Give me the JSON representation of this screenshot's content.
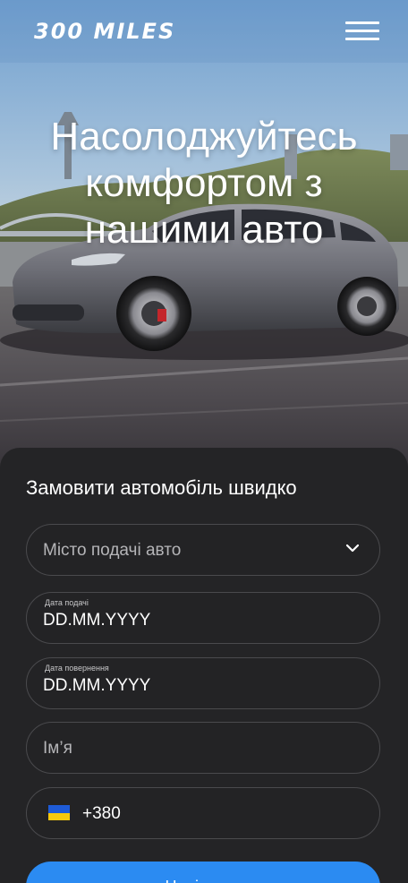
{
  "header": {
    "logo": "300 MILES"
  },
  "hero": {
    "title": "Насолоджуйтесь комфортом з нашими авто"
  },
  "form": {
    "title": "Замовити автомобіль швидко",
    "city": {
      "placeholder": "Місто подачі авто"
    },
    "pickup_date": {
      "label": "Дата подачі",
      "value": "DD.MM.YYYY"
    },
    "return_date": {
      "label": "Дата повернення",
      "value": "DD.MM.YYYY"
    },
    "name": {
      "placeholder": "Ім’я"
    },
    "phone": {
      "code": "+380"
    },
    "submit_label": "Надіслати"
  },
  "colors": {
    "accent": "#2b8bf2",
    "panel": "#242426",
    "flag_blue": "#1e5bd7",
    "flag_yellow": "#f6c90e"
  }
}
